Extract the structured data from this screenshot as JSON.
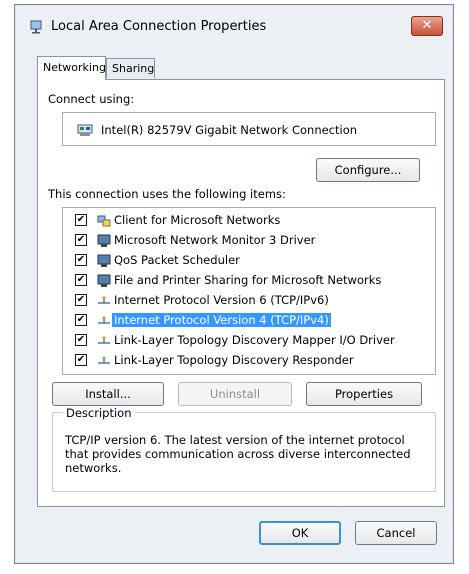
{
  "window": {
    "title": "Local Area Connection Properties",
    "close_label": "✕"
  },
  "tabs": [
    {
      "label": "Networking"
    },
    {
      "label": "Sharing"
    }
  ],
  "connect": {
    "label": "Connect using:",
    "adapter": "Intel(R) 82579V Gigabit Network Connection",
    "configure_label": "Configure..."
  },
  "items_label": "This connection uses the following items:",
  "items": [
    {
      "label": "Client for Microsoft Networks",
      "checked": true,
      "icon": "network-client-icon"
    },
    {
      "label": "Microsoft Network Monitor 3 Driver",
      "checked": true,
      "icon": "network-driver-icon"
    },
    {
      "label": "QoS Packet Scheduler",
      "checked": true,
      "icon": "scheduler-icon"
    },
    {
      "label": "File and Printer Sharing for Microsoft Networks",
      "checked": true,
      "icon": "file-printer-sharing-icon"
    },
    {
      "label": "Internet Protocol Version 6 (TCP/IPv6)",
      "checked": true,
      "icon": "protocol-icon"
    },
    {
      "label": "Internet Protocol Version 4 (TCP/IPv4)",
      "checked": true,
      "icon": "protocol-icon",
      "selected": true
    },
    {
      "label": "Link-Layer Topology Discovery Mapper I/O Driver",
      "checked": true,
      "icon": "protocol-icon"
    },
    {
      "label": "Link-Layer Topology Discovery Responder",
      "checked": true,
      "icon": "protocol-icon"
    }
  ],
  "buttons": {
    "install": "Install...",
    "uninstall": "Uninstall",
    "properties": "Properties",
    "ok": "OK",
    "cancel": "Cancel"
  },
  "description": {
    "legend": "Description",
    "text": "TCP/IP version 6. The latest version of the internet protocol that provides communication across diverse interconnected networks."
  },
  "colors": {
    "selection": "#3399ff",
    "close_button": "#c8533a",
    "default_button_border": "#3d8fd6"
  }
}
